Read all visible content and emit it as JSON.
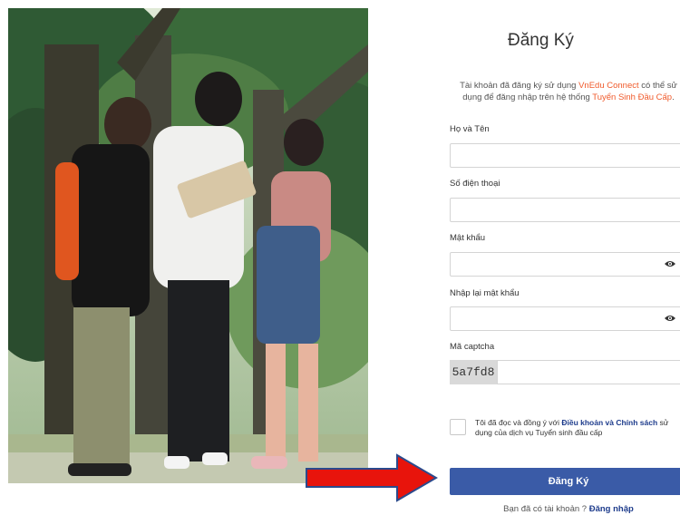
{
  "form": {
    "title": "Đăng Ký",
    "subtitle_pre": "Tài khoản đã đăng ký sử dụng ",
    "subtitle_brand": "VnEdu Connect",
    "subtitle_mid": " có thể sử dụng để đăng nhập trên hệ thống ",
    "subtitle_system": "Tuyển Sinh Đầu Cấp",
    "subtitle_end": ".",
    "fields": {
      "name_label": "Họ và Tên",
      "phone_label": "Số điện thoại",
      "password_label": "Mật khẩu",
      "confirm_label": "Nhập lại mật khẩu",
      "captcha_label": "Mã captcha"
    },
    "captcha_code": "5a7fd8",
    "agree_pre": "Tôi đã đọc và đồng ý với ",
    "agree_link": "Điều khoản và Chính sách",
    "agree_post": " sử dụng của dịch vụ Tuyển sinh đầu cấp",
    "submit_label": "Đăng Ký",
    "login_prompt": "Bạn đã có tài khoản ? ",
    "login_link": "Đăng nhập"
  },
  "icons": {
    "password_toggle": "eye-icon",
    "annotation": "red-arrow-icon"
  },
  "colors": {
    "accent_orange": "#f05a2b",
    "primary_button": "#3a5ba7",
    "link_blue": "#1e3c8c",
    "arrow_red": "#e8140c",
    "arrow_outline": "#2b4a8c"
  }
}
